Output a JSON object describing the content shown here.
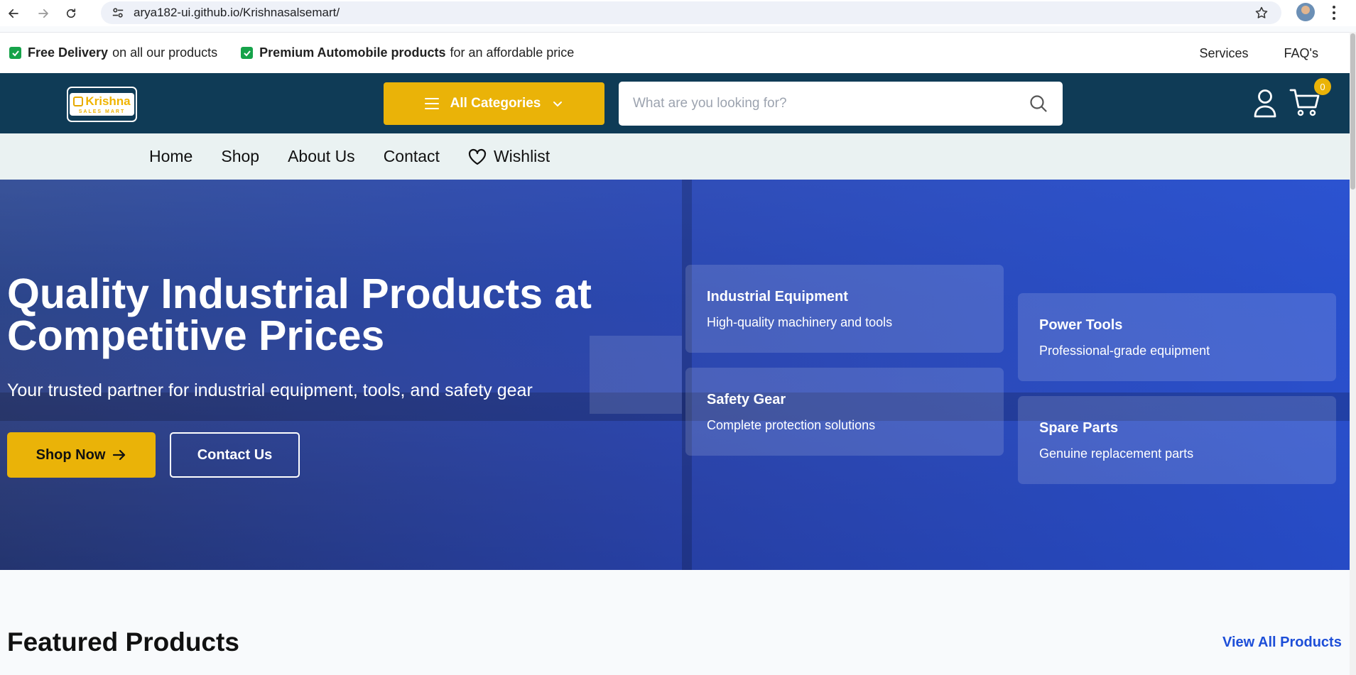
{
  "browser": {
    "url": "arya182-ui.github.io/Krishnasalsemart/"
  },
  "promo": {
    "item1_bold": "Free Delivery",
    "item1_text": "on all our products",
    "item2_bold": "Premium Automobile products",
    "item2_text": "for an affordable price",
    "links": [
      "Services",
      "FAQ's"
    ]
  },
  "header": {
    "logo_text": "Krishna",
    "logo_sub": "SALES MART",
    "all_categories": "All Categories",
    "search_placeholder": "What are you looking for?",
    "cart_count": "0"
  },
  "nav": {
    "items": [
      "Home",
      "Shop",
      "About Us",
      "Contact"
    ],
    "wishlist": "Wishlist"
  },
  "hero": {
    "title": "Quality Industrial Products at Competitive Prices",
    "subtitle": "Your trusted partner for industrial equipment, tools, and safety gear",
    "shop_now": "Shop Now",
    "contact_us": "Contact Us",
    "cards": [
      {
        "title": "Industrial Equipment",
        "desc": "High-quality machinery and tools"
      },
      {
        "title": "Power Tools",
        "desc": "Professional-grade equipment"
      },
      {
        "title": "Safety Gear",
        "desc": "Complete protection solutions"
      },
      {
        "title": "Spare Parts",
        "desc": "Genuine replacement parts"
      }
    ]
  },
  "featured": {
    "title": "Featured Products",
    "view_all": "View All Products"
  },
  "colors": {
    "header_bg": "#0f3b56",
    "accent": "#eab308",
    "hero_overlay": "#2550dc",
    "link": "#1d4ed8",
    "check": "#16a34a"
  }
}
